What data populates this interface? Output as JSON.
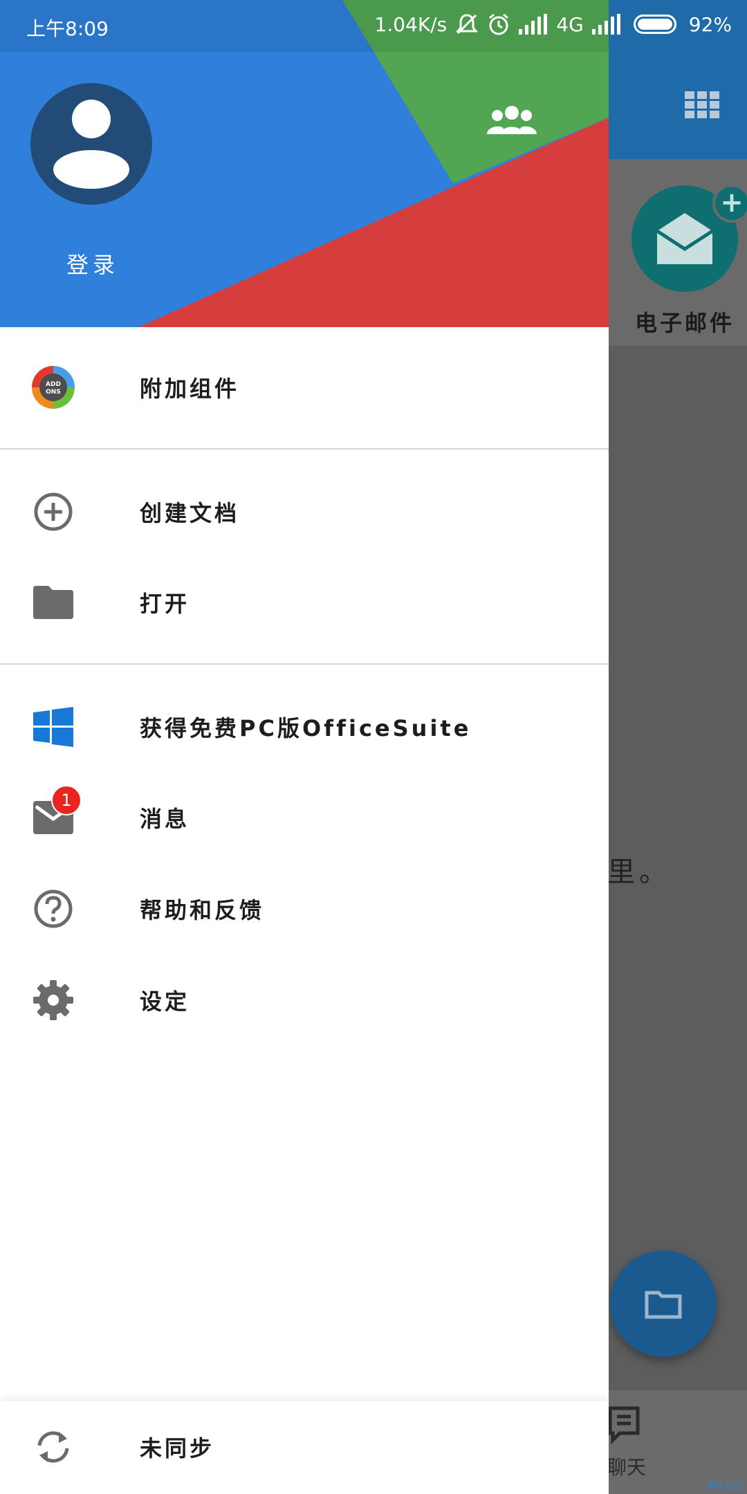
{
  "status_bar": {
    "time": "上午8:09",
    "speed": "1.04K/s",
    "network": "4G",
    "battery_percent": "92%"
  },
  "colors": {
    "header_blue": "#2f7fdb",
    "header_green": "#52a653",
    "header_red": "#d63e3e",
    "avatar_bg": "#234b78",
    "icon_gray": "#6b6b6b",
    "windows_blue": "#1878d6",
    "badge_red": "#e8261e"
  },
  "drawer": {
    "header": {
      "login_label": "登录",
      "accounts_icon": "group-icon",
      "avatar_icon": "person-icon"
    },
    "sections": [
      [
        {
          "label": "附加组件",
          "icon": "addons-gear-icon"
        }
      ],
      [
        {
          "label": "创建文档",
          "icon": "add-circle-icon"
        },
        {
          "label": "打开",
          "icon": "folder-icon"
        }
      ],
      [
        {
          "label": "获得免费PC版OfficeSuite",
          "icon": "windows-logo-icon"
        },
        {
          "label": "消息",
          "icon": "mail-icon",
          "badge": "1"
        },
        {
          "label": "帮助和反馈",
          "icon": "help-circle-icon"
        },
        {
          "label": "设定",
          "icon": "gear-icon"
        }
      ]
    ],
    "footer": {
      "label": "未同步",
      "icon": "sync-icon"
    }
  },
  "background": {
    "mail_tile_label": "电子邮件",
    "empty_text": "里。",
    "chat_label": "聊天",
    "watermark": "游戏社区"
  }
}
